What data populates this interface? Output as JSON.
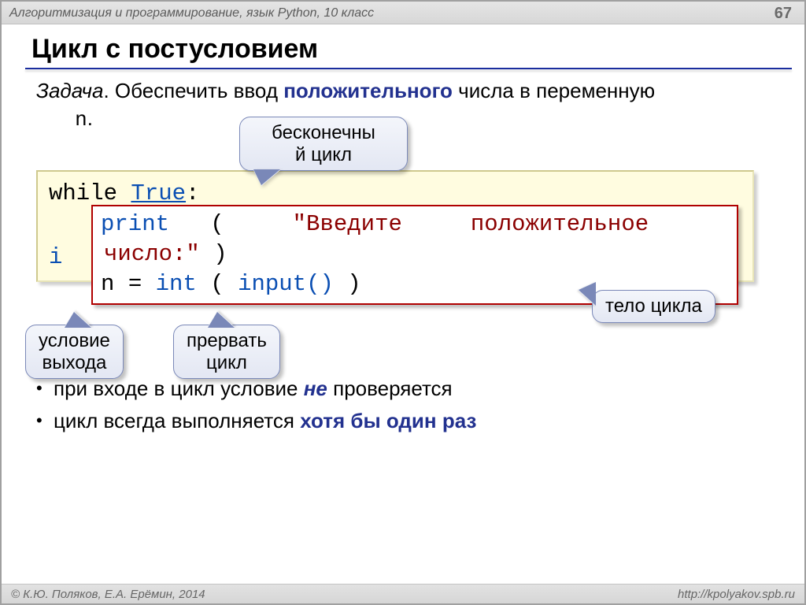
{
  "header": {
    "course": "Алгоритмизация и программирование, язык Python, 10 класс",
    "page": "67"
  },
  "title": "Цикл с постусловием",
  "task": {
    "label": "Задача",
    "pre": ". Обеспечить ввод ",
    "bold": "положительного",
    "post": " числа в переменную ",
    "var": "n",
    "tail": "."
  },
  "callouts": {
    "infinite_loop": "бесконечны\nй цикл",
    "loop_body": "тело цикла",
    "exit_cond": "условие\nвыхода",
    "break_loop": "прервать\nцикл"
  },
  "code": {
    "while": "while",
    "true": "True",
    "colon": ":",
    "prefix_i": "i",
    "print": "print",
    "lpar": "(",
    "str1": "\"Введите",
    "str2": "положительное",
    "str_line2": "число:\"",
    "rpar": ")",
    "assign_n": "n",
    "eq": "=",
    "int": "int",
    "input": "input()"
  },
  "bullets": {
    "b1_pre": "при входе в цикл условие ",
    "b1_em": "не",
    "b1_post": " проверяется",
    "b2_pre": "цикл всегда выполняется ",
    "b2_bold": "хотя бы один раз"
  },
  "footer": {
    "left": "© К.Ю. Поляков, Е.А. Ерёмин, 2014",
    "right": "http://kpolyakov.spb.ru"
  }
}
